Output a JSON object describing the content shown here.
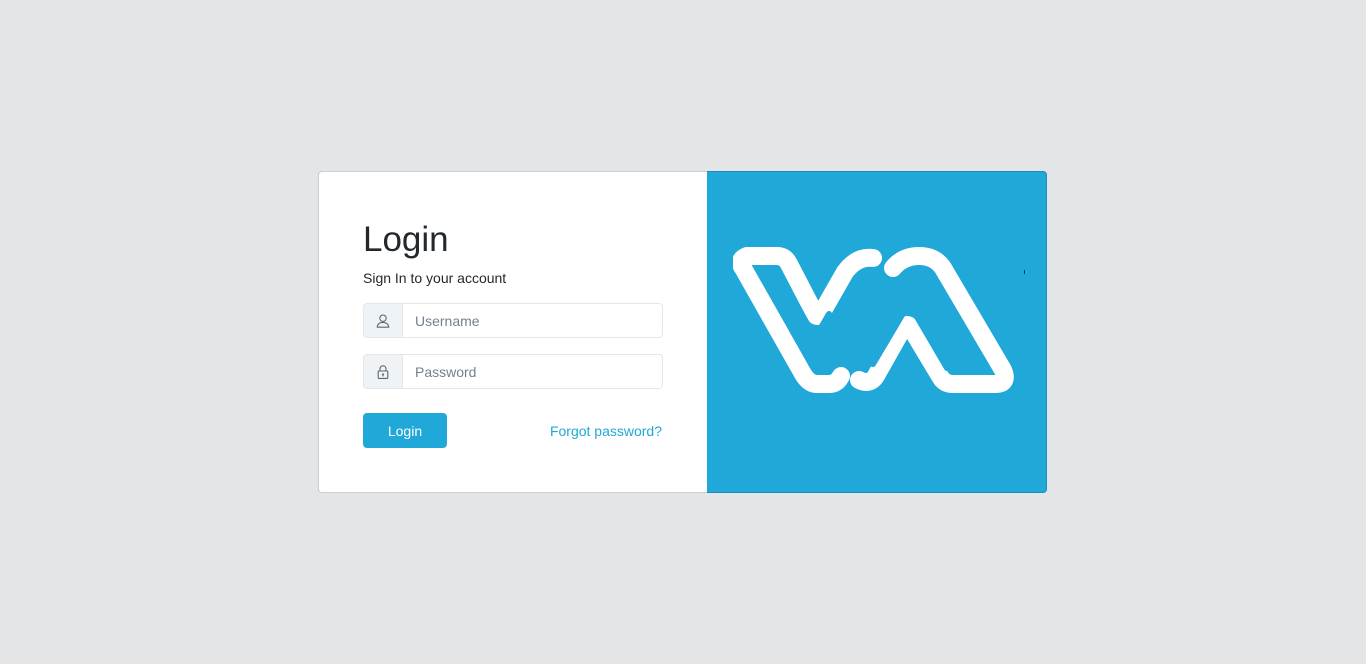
{
  "login": {
    "title": "Login",
    "subtitle": "Sign In to your account",
    "username": {
      "placeholder": "Username",
      "value": "",
      "icon": "user-icon"
    },
    "password": {
      "placeholder": "Password",
      "value": "",
      "icon": "lock-icon"
    },
    "submit_label": "Login",
    "forgot_label": "Forgot password?"
  },
  "brand": {
    "logo": "va-logo",
    "background_color": "#20a8d8",
    "logo_color": "#ffffff"
  },
  "colors": {
    "page_background": "#e4e5e6",
    "primary": "#20a8d8",
    "text": "#23282c"
  }
}
